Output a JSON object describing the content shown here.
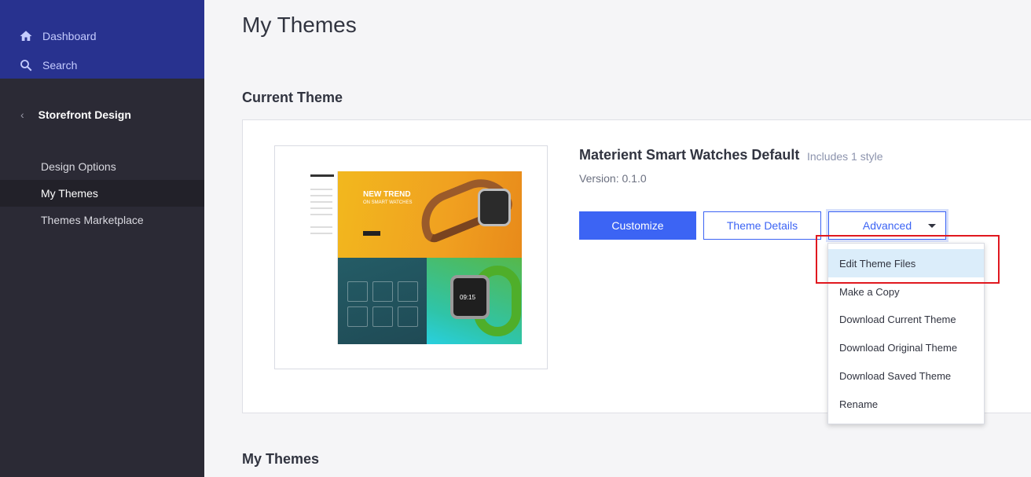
{
  "sidebar": {
    "dashboard_label": "Dashboard",
    "search_label": "Search",
    "section_title": "Storefront Design",
    "items": [
      {
        "label": "Design Options"
      },
      {
        "label": "My Themes"
      },
      {
        "label": "Themes Marketplace"
      }
    ]
  },
  "main": {
    "page_title": "My Themes",
    "current_theme_heading": "Current Theme",
    "my_themes_heading": "My Themes"
  },
  "theme": {
    "name": "Materient Smart Watches Default",
    "styles": "Includes 1 style",
    "version": "Version: 0.1.0",
    "preview": {
      "hero_title": "NEW TREND",
      "hero_subtitle": "ON SMART WATCHES",
      "watch_time": "09:15"
    }
  },
  "buttons": {
    "customize": "Customize",
    "theme_details": "Theme Details",
    "advanced": "Advanced"
  },
  "advanced_menu": {
    "items": [
      "Edit Theme Files",
      "Make a Copy",
      "Download Current Theme",
      "Download Original Theme",
      "Download Saved Theme",
      "Rename"
    ]
  },
  "colors": {
    "sidebar_bg": "#2b2a35",
    "sidebar_top_bg": "#28328f",
    "primary": "#3c64f4",
    "highlight": "#e0181f"
  }
}
